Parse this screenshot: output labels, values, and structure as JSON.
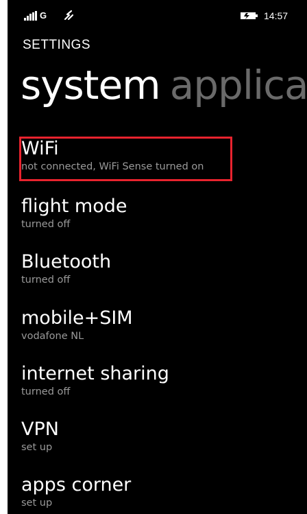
{
  "status_bar": {
    "network_type": "G",
    "time": "14:57",
    "icons": [
      "signal-strength-icon",
      "data-connection-icon",
      "battery-icon"
    ]
  },
  "header": {
    "app_title": "SETTINGS",
    "pivot_active": "system",
    "pivot_next": "applica"
  },
  "settings": [
    {
      "title": "WiFi",
      "subtitle": "not connected, WiFi Sense turned on",
      "highlighted": true
    },
    {
      "title": "flight mode",
      "subtitle": "turned off"
    },
    {
      "title": "Bluetooth",
      "subtitle": "turned off"
    },
    {
      "title": "mobile+SIM",
      "subtitle": "vodafone NL"
    },
    {
      "title": "internet sharing",
      "subtitle": "turned off"
    },
    {
      "title": "VPN",
      "subtitle": "set up"
    },
    {
      "title": "apps corner",
      "subtitle": "set up"
    }
  ],
  "colors": {
    "background": "#000000",
    "text": "#ffffff",
    "subtitle": "#9a9a9a",
    "pivot_inactive": "#6a6a6a",
    "highlight": "#e8232e"
  }
}
